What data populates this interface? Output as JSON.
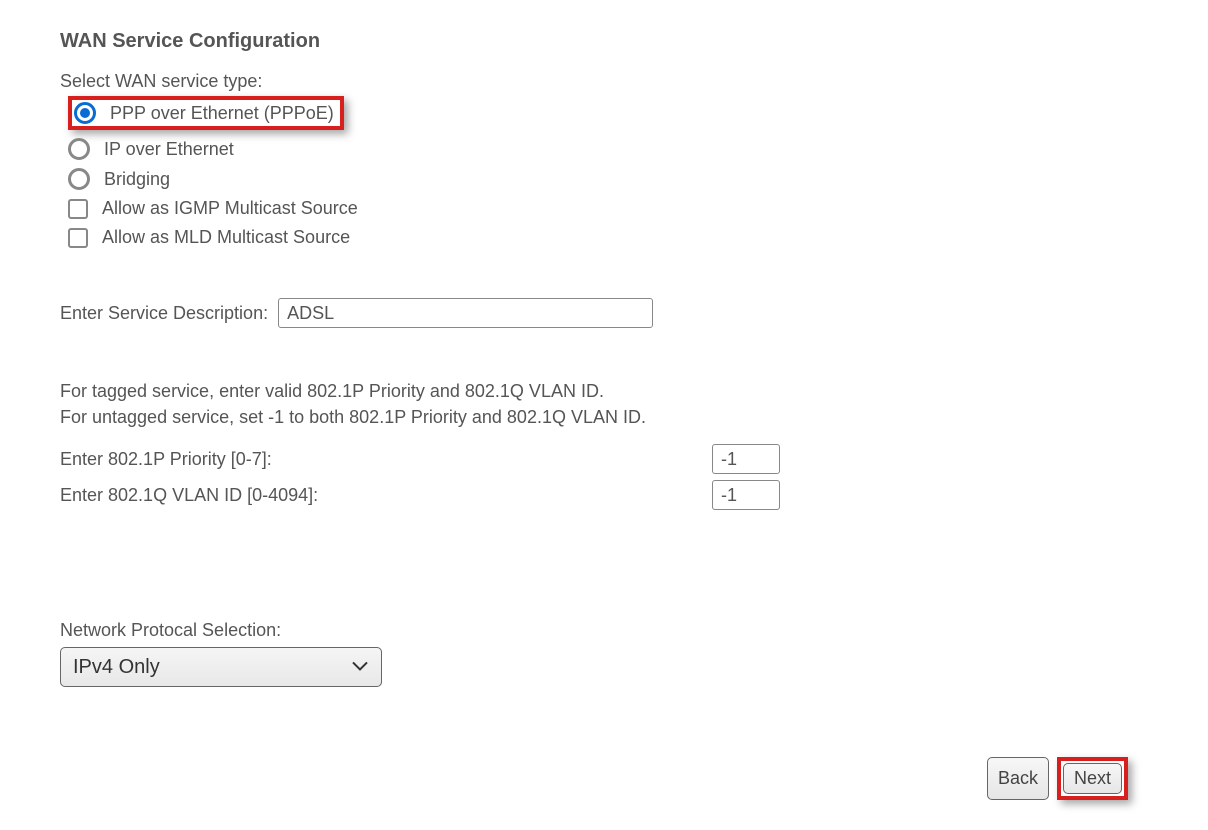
{
  "title": "WAN Service Configuration",
  "select_label": "Select WAN service type:",
  "service_types": [
    {
      "label": "PPP over Ethernet (PPPoE)",
      "selected": true,
      "highlighted": true
    },
    {
      "label": "IP over Ethernet",
      "selected": false,
      "highlighted": false
    },
    {
      "label": "Bridging",
      "selected": false,
      "highlighted": false
    }
  ],
  "checkboxes": [
    {
      "label": "Allow as IGMP Multicast Source",
      "checked": false
    },
    {
      "label": "Allow as MLD Multicast Source",
      "checked": false
    }
  ],
  "service_description": {
    "label": "Enter Service Description:",
    "value": "ADSL"
  },
  "help_line1": "For tagged service, enter valid 802.1P Priority and 802.1Q VLAN ID.",
  "help_line2": "For untagged service, set -1 to both 802.1P Priority and 802.1Q VLAN ID.",
  "priority": {
    "label": "Enter 802.1P Priority [0-7]:",
    "value": "-1"
  },
  "vlan": {
    "label": "Enter 802.1Q VLAN ID [0-4094]:",
    "value": "-1"
  },
  "protocol": {
    "label": "Network Protocal Selection:",
    "selected": "IPv4 Only"
  },
  "buttons": {
    "back": "Back",
    "next": "Next"
  }
}
